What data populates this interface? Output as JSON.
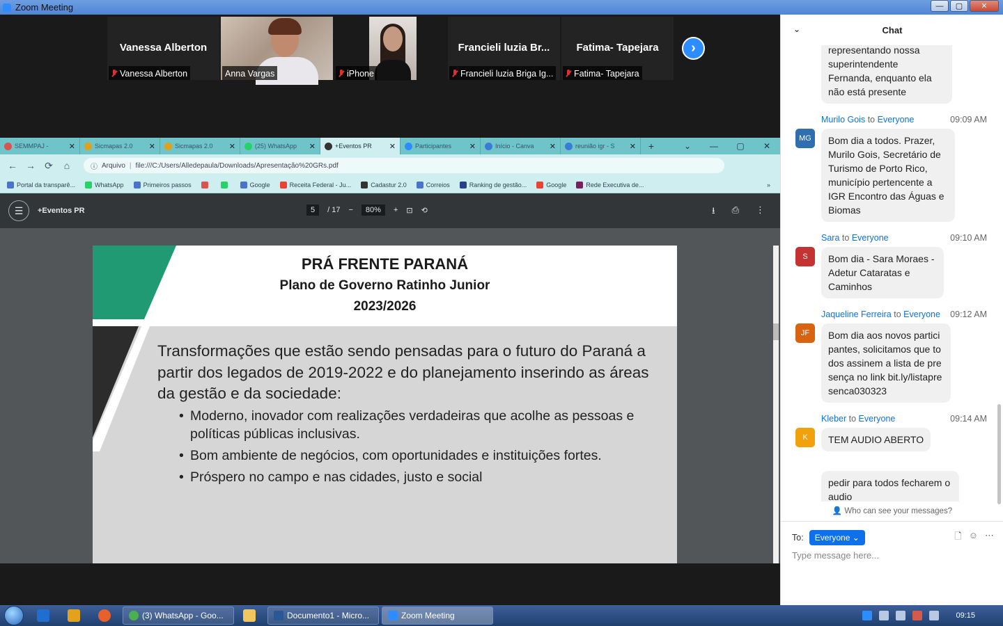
{
  "window": {
    "title": "Zoom Meeting",
    "min": "—",
    "max": "▢",
    "close": "✕"
  },
  "participants": [
    {
      "display": "Vanessa Alberton",
      "caption": "Vanessa Alberton",
      "muted": true
    },
    {
      "display": "",
      "caption": "Anna Vargas",
      "muted": false
    },
    {
      "display": "",
      "caption": "iPhone",
      "muted": true
    },
    {
      "display": "Francieli luzia Br...",
      "caption": "Francieli luzia Briga Ig...",
      "muted": true
    },
    {
      "display": "Fatima- Tapejara",
      "caption": "Fatima- Tapejara",
      "muted": true
    }
  ],
  "next_page": "›",
  "browser": {
    "tabs": [
      "SEMMPAJ -",
      "Sicmapas 2.0",
      "Sicmapas 2.0",
      "(25) WhatsApp",
      "+Eventos PR",
      "Participantes",
      "Início - Canva",
      "reunião igr - S"
    ],
    "tab_plus": "+",
    "tab_controls": [
      "⌄",
      "—",
      "▢",
      "✕"
    ],
    "nav": {
      "back": "←",
      "forward": "→",
      "reload": "⟳",
      "home": "⌂"
    },
    "address": {
      "label": "Arquivo",
      "url": "file:///C:/Users/Alledepaula/Downloads/Apresentação%20GRs.pdf"
    },
    "bookmarks": [
      "Portal da transparê...",
      "WhatsApp",
      "Primeiros passos",
      "",
      "",
      "Google",
      "Receita Federal - Ju...",
      "Cadastur 2.0",
      "Correios",
      "Ranking de gestão...",
      "Google",
      "Rede Executiva de..."
    ],
    "more": "»"
  },
  "pdf": {
    "doc_name": "+Eventos PR",
    "page": "5",
    "page_total": "/ 17",
    "minus": "−",
    "zoom": "80%",
    "plus": "+",
    "menu": "☰"
  },
  "slide": {
    "title": "PRÁ FRENTE PARANÁ",
    "subtitle": "Plano de Governo Ratinho Junior",
    "years": "2023/2026",
    "lead": "Transformações que estão sendo pensadas para o futuro do Paraná a partir dos legados de 2019-2022 e do planejamento inserindo as áreas da gestão e da sociedade:",
    "bullets": [
      "Moderno, inovador com realizações verdadeiras que acolhe as pessoas e políticas públicas inclusivas.",
      "Bom ambiente de negócios, com oportunidades e instituições fortes.",
      "Próspero no campo e nas cidades, justo e social"
    ]
  },
  "chat": {
    "title": "Chat",
    "messages": [
      {
        "sender": "",
        "to": "",
        "time": "",
        "initials": "",
        "color": "#ffffff",
        "text": "representando nossa superintendente Fernanda, enquanto ela não está presente"
      },
      {
        "sender": "Murilo Gois",
        "to": "Everyone",
        "time": "09:09 AM",
        "initials": "MG",
        "color": "#2f6fb0",
        "text": "Bom dia a todos. Prazer, Murilo Gois, Secretário de Turismo de Porto Rico, município pertencente a IGR Encontro das Águas e Biomas"
      },
      {
        "sender": "Sara",
        "to": "Everyone",
        "time": "09:10 AM",
        "initials": "S",
        "color": "#c43232",
        "text": "Bom dia - Sara Moraes - Adetur Cataratas e Caminhos"
      },
      {
        "sender": "Jaqueline Ferreira",
        "to": "Everyone",
        "time": "09:12 AM",
        "initials": "JF",
        "color": "#d86412",
        "text": "Bom dia aos novos participantes, solicitamos que todos assinem a lista de presença no link bit.ly/listapresenca030323"
      },
      {
        "sender": "Kleber",
        "to": "Everyone",
        "time": "09:14 AM",
        "initials": "K",
        "color": "#f0a10c",
        "text": "TEM AUDIO ABERTO"
      },
      {
        "sender": "",
        "to": "",
        "time": "",
        "initials": "",
        "color": "#ffffff",
        "text": "pedir para todos fecharem o audio"
      }
    ],
    "to_word": "to",
    "who_can_see": "Who can see your messages?",
    "to_label": "To:",
    "recipient": "Everyone",
    "placeholder": "Type message here..."
  },
  "taskbar": {
    "buttons": [
      "(3) WhatsApp - Goo...",
      "Documento1 - Micro...",
      "Zoom Meeting"
    ],
    "clock": "09:15"
  }
}
